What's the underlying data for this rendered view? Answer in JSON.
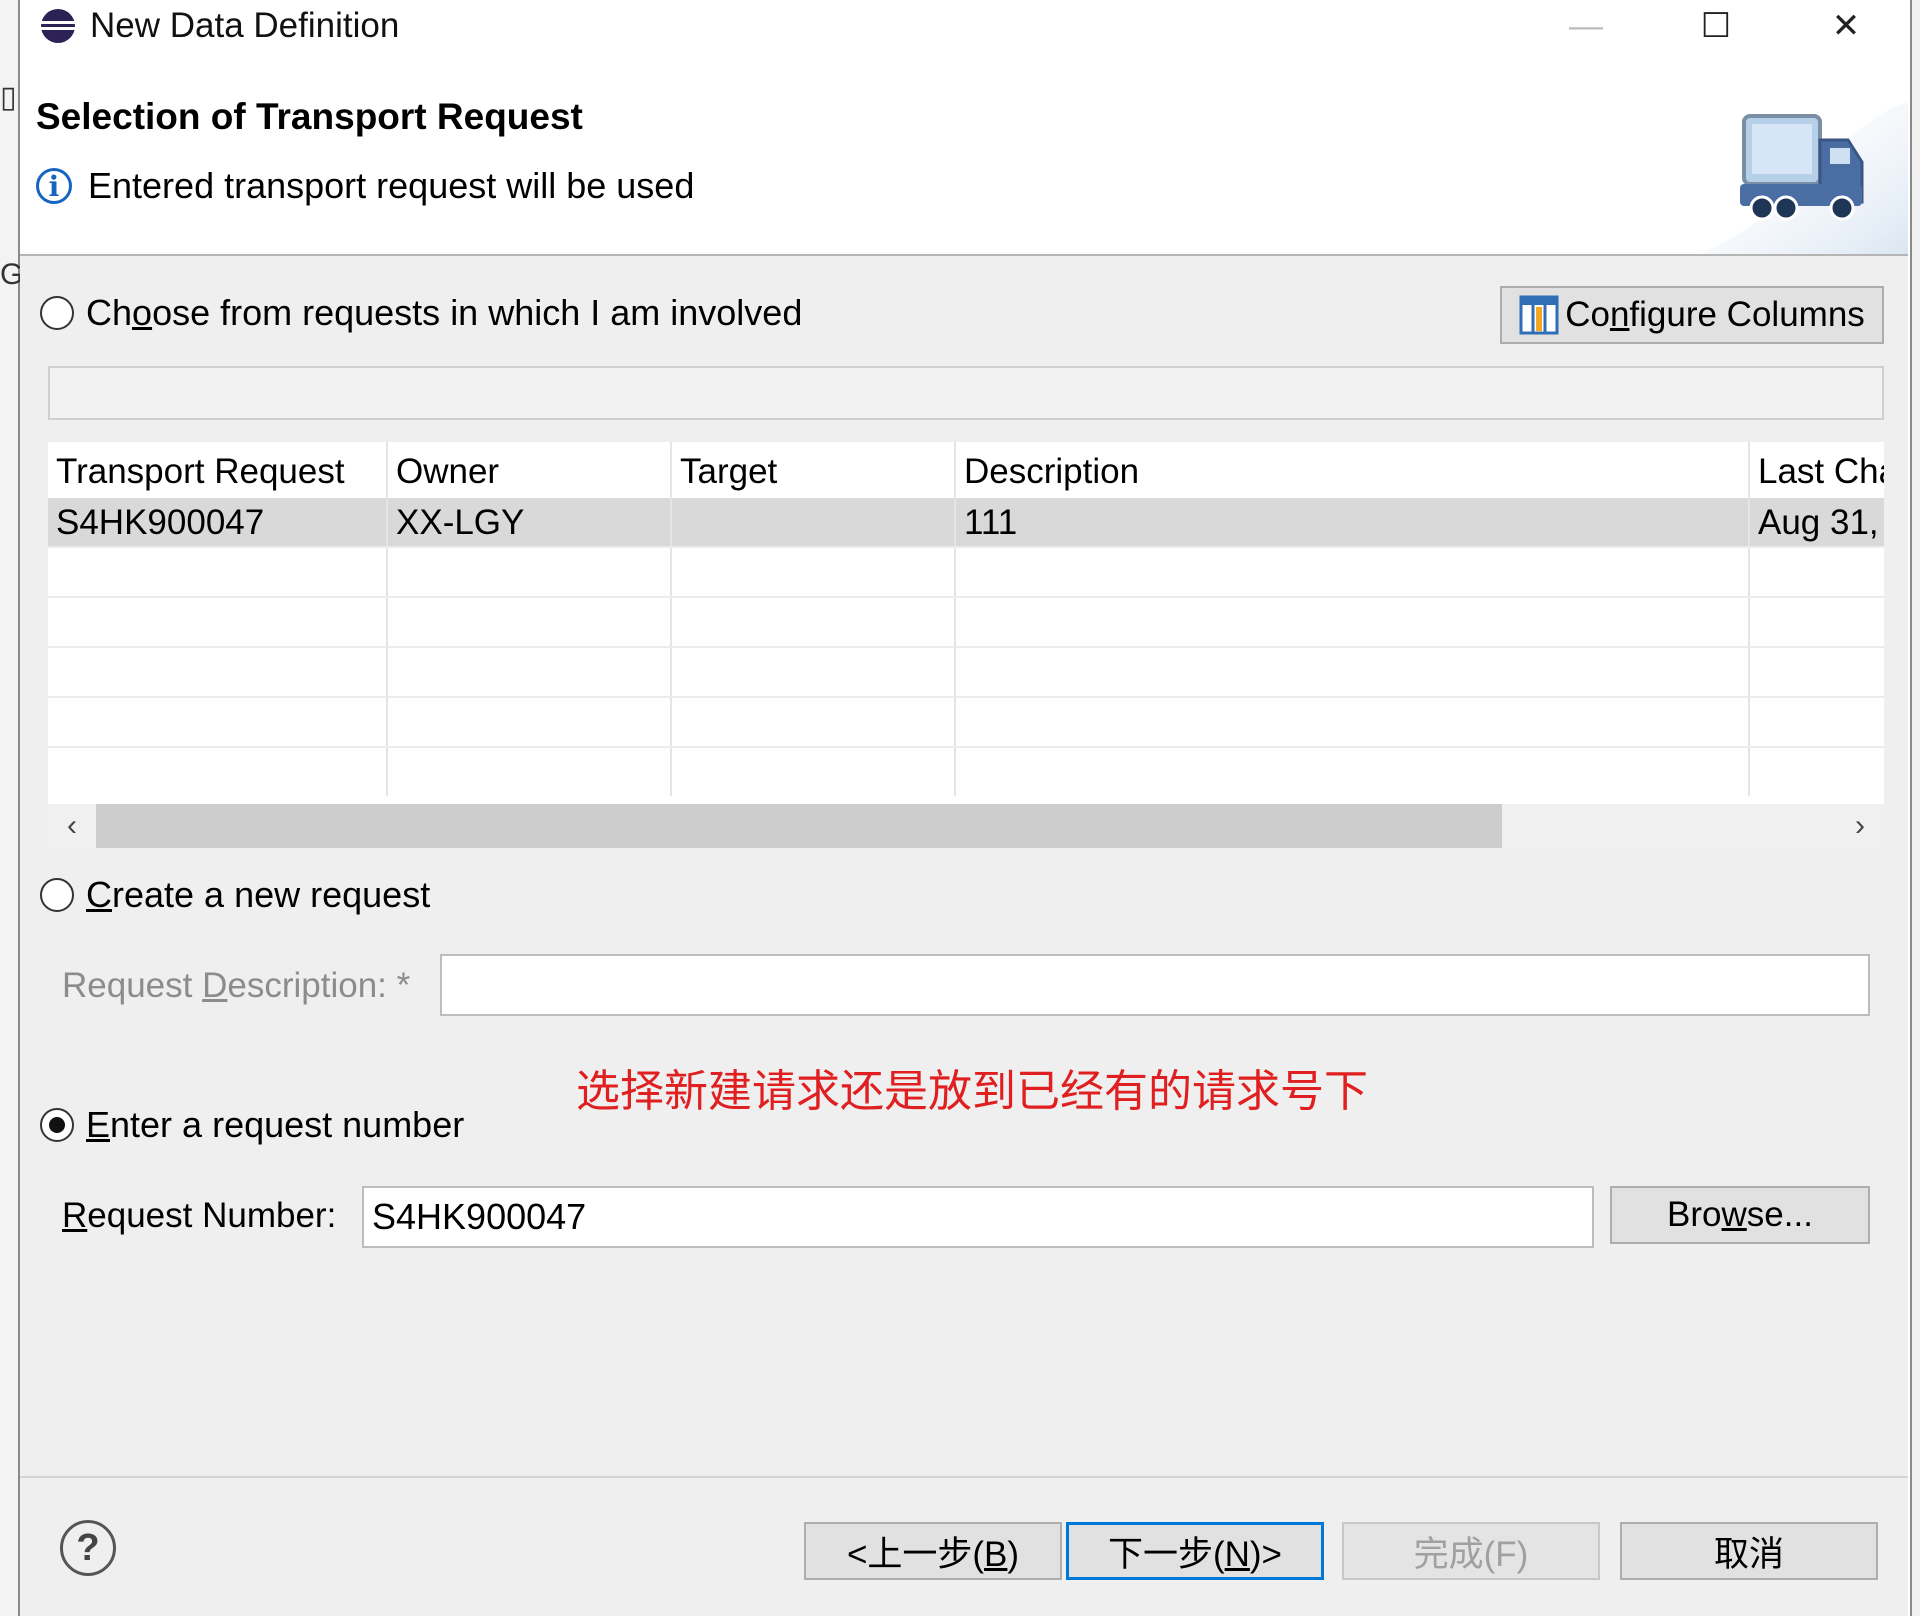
{
  "window": {
    "title": "New Data Definition",
    "controls": {
      "minimize": "—",
      "maximize": "☐",
      "close": "✕"
    }
  },
  "banner": {
    "title": "Selection of Transport Request",
    "message": "Entered transport request will be used",
    "message_icon": "info-icon",
    "image_icon": "transport-truck-icon"
  },
  "choose_option": {
    "label_pre": "Ch",
    "label_mnemonic": "o",
    "label_post": "ose from requests in which I am involved",
    "checked": false
  },
  "configure_columns": {
    "label_pre": "Co",
    "label_mnemonic": "n",
    "label_post": "figure Columns",
    "icon": "columns-icon"
  },
  "table": {
    "columns": [
      "Transport Request",
      "Owner",
      "Target",
      "Description",
      "Last Cha"
    ],
    "rows": [
      {
        "request": "S4HK900047",
        "owner": "XX-LGY",
        "target": "",
        "description": "111",
        "last_changed": "Aug 31,"
      }
    ],
    "scroll_left": "‹",
    "scroll_right": "›"
  },
  "create_option": {
    "label_mnemonic": "C",
    "label_post": "reate a new request",
    "checked": false,
    "description_label_pre": "Request ",
    "description_label_mnemonic": "D",
    "description_label_post": "escription: *",
    "description_value": ""
  },
  "annotation": "选择新建请求还是放到已经有的请求号下",
  "enter_option": {
    "label_mnemonic": "E",
    "label_post": "nter a request number",
    "checked": true,
    "number_label_mnemonic": "R",
    "number_label_post": "equest Number:",
    "number_value": "S4HK900047",
    "browse_pre": "Bro",
    "browse_mnemonic": "w",
    "browse_post": "se..."
  },
  "footer": {
    "help_icon": "help-icon",
    "back": {
      "pre": "<上一步(",
      "mn": "B",
      "post": ")"
    },
    "next": {
      "pre": "下一步(",
      "mn": "N",
      "post": ")>"
    },
    "finish": "完成(F)",
    "cancel": "取消"
  },
  "colors": {
    "accent": "#0078d7",
    "annotation": "#e02020",
    "selected_row": "#d9d9d9",
    "info": "#1565c0"
  }
}
